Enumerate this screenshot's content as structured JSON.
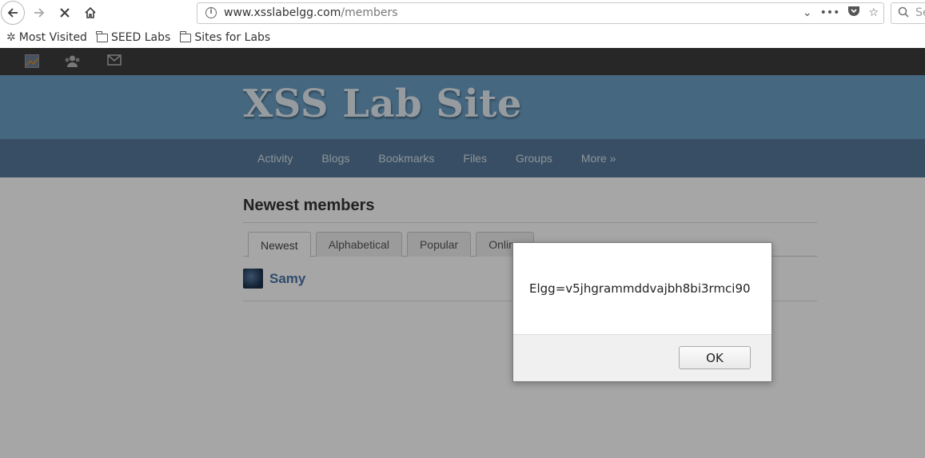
{
  "browser": {
    "url_host": "www.xsslabelgg.com",
    "url_path": "/members",
    "search_placeholder": "Se",
    "bookmarks": [
      {
        "label": "Most Visited",
        "icon": "gear-icon"
      },
      {
        "label": "SEED Labs",
        "icon": "folder-icon"
      },
      {
        "label": "Sites for Labs",
        "icon": "folder-icon"
      }
    ]
  },
  "site": {
    "title": "XSS Lab Site",
    "menu": [
      "Activity",
      "Blogs",
      "Bookmarks",
      "Files",
      "Groups",
      "More »"
    ]
  },
  "content": {
    "heading": "Newest members",
    "tabs": [
      "Newest",
      "Alphabetical",
      "Popular",
      "Online"
    ],
    "active_tab": "Newest",
    "members": [
      {
        "name": "Samy"
      }
    ]
  },
  "dialog": {
    "message": "Elgg=v5jhgrammddvajbh8bi3rmci90",
    "ok_label": "OK"
  }
}
